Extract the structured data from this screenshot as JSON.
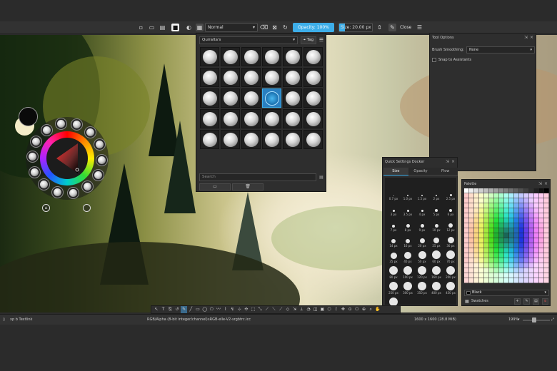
{
  "toolbar": {
    "blend_mode": "Normal",
    "opacity_label": "Opacity:  100%",
    "opacity_value": 1.0,
    "size_label": "Size:  20.00 px",
    "close_label": "Close"
  },
  "brush_popup": {
    "tag": "Quiralta's",
    "tag_button": "Tag",
    "search_placeholder": "Search",
    "rows": 5,
    "cols": 6,
    "selected_index": 15
  },
  "tool_options": {
    "title": "Tool Options",
    "smoothing_label": "Brush Smoothing:",
    "smoothing_value": "None",
    "snap_label": "Snap to Assistants"
  },
  "quick_settings": {
    "title": "Quick Settings Docker",
    "tabs": [
      "Size",
      "Opacity",
      "Flow"
    ],
    "sizes": [
      "0.7 px",
      "1.0 px",
      "1.5 px",
      "2 px",
      "2.5 px",
      "3 px",
      "3.5 px",
      "4 px",
      "5 px",
      "6 px",
      "7 px",
      "8 px",
      "9 px",
      "10 px",
      "12 px",
      "14 px",
      "16 px",
      "20 px",
      "25 px",
      "30 px",
      "35 px",
      "40 px",
      "50 px",
      "60 px",
      "70 px",
      "80 px",
      "100 px",
      "120 px",
      "160 px",
      "200 px",
      "250 px",
      "300 px",
      "350 px",
      "400 px",
      "450 px",
      "500 px"
    ]
  },
  "palette": {
    "title": "Palette",
    "color_name": "Black",
    "palette_name": "Swatches"
  },
  "status": {
    "brush": "xp b Textlink",
    "color_model": "RGB/Alpha (8-bit integer/channel)",
    "profile": "sRGB-elle-V2-srgbtrc.icc",
    "dimensions": "1600 x 1600 (28.8 MiB)",
    "zoom": "199%"
  }
}
